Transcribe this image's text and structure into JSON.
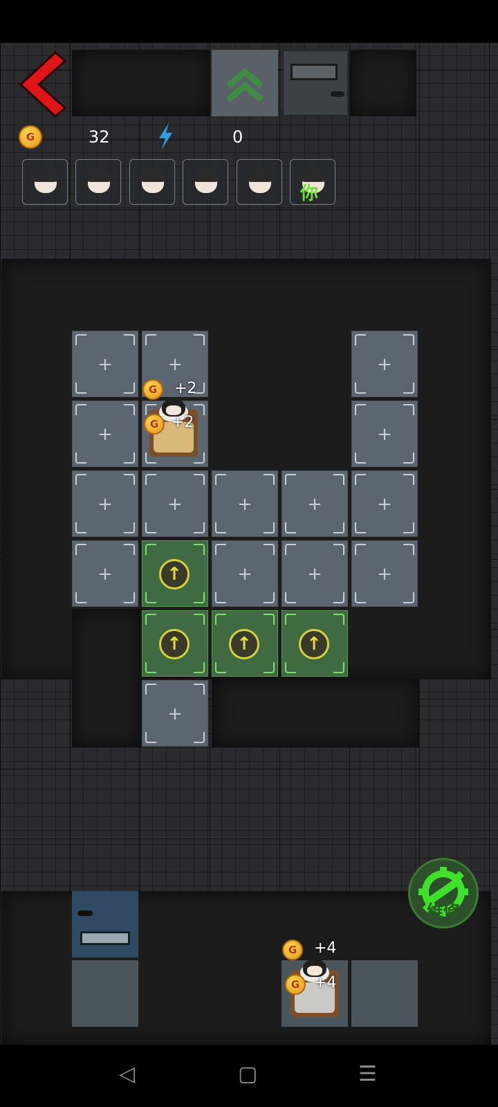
{
  "hud": {
    "gold_icon": "gold-coin-icon",
    "gold": "32",
    "energy_icon": "lightning-icon",
    "energy": "0",
    "back_icon": "red-chevron-left-icon",
    "coin_letter": "G"
  },
  "roster": [
    {
      "name": "girl-avatar-1",
      "tag": ""
    },
    {
      "name": "girl-avatar-2",
      "tag": ""
    },
    {
      "name": "boy-avatar",
      "tag": ""
    },
    {
      "name": "girl-avatar-3",
      "tag": ""
    },
    {
      "name": "dark-hair-avatar",
      "tag": ""
    },
    {
      "name": "ghost-avatar",
      "tag": "你"
    }
  ],
  "room_upper": {
    "bed_income_1": "+2",
    "bed_income_2": "+2",
    "upgrade_arrow": "↑",
    "empty_cell": "+"
  },
  "room_lower": {
    "bed_income_1": "+4",
    "bed_income_2": "+4"
  },
  "repair": {
    "label": "维修",
    "icon": "gear-wrench-icon"
  },
  "nav": {
    "back": "◁",
    "home": "▢",
    "menu": "☰"
  },
  "colors": {
    "accent_green": "#5a9a55",
    "upgrade_yellow": "#d8d23a",
    "back_red": "#e01515"
  }
}
